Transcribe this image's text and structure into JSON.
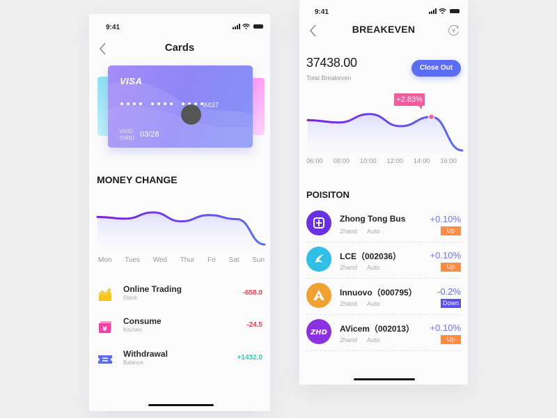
{
  "left_screen": {
    "status": {
      "time": "9:41"
    },
    "nav": {
      "title": "Cards"
    },
    "card": {
      "brand": "VISA",
      "last4": "8437",
      "valid_label": "VAIID THRU",
      "valid_date": "03/28"
    },
    "money_change": {
      "title": "MONEY CHANGE"
    },
    "transactions": [
      {
        "name": "Online Trading",
        "sub": "Stock",
        "amount": "-658.0",
        "icon": "trend-chart-icon",
        "amount_color": "#e8404f"
      },
      {
        "name": "Consume",
        "sub": "Kitchen",
        "amount": "-24.5",
        "icon": "ticket-icon",
        "amount_color": "#e8404f"
      },
      {
        "name": "Withdrawal",
        "sub": "Balance",
        "amount": "+1432.0",
        "icon": "voucher-icon",
        "amount_color": "#2dcfb3"
      }
    ]
  },
  "right_screen": {
    "status": {
      "time": "9:41"
    },
    "nav": {
      "title": "BREAKEVEN"
    },
    "total": {
      "amount": "37438.00",
      "label": "Total Breakeven"
    },
    "close_out_label": "Close Out",
    "tooltip": "+2.83%",
    "position_title": "POISITON",
    "positions": [
      {
        "name": "Zhong Tong Bus",
        "tag1": "2hand",
        "tag2": "Auto",
        "change": "+0.10%",
        "badge": "Up",
        "avatar_color": "#6a2fe0",
        "change_color": "#6f77f2",
        "badge_color": "#ff8b45"
      },
      {
        "name": "LCE（002036）",
        "tag1": "2hand",
        "tag2": "Auto",
        "change": "+0.10%",
        "badge": "Up",
        "avatar_color": "#30bfe6",
        "change_color": "#6f77f2",
        "badge_color": "#ff8b45"
      },
      {
        "name": "Innuovo（000795）",
        "tag1": "2hand",
        "tag2": "Auto",
        "change": "-0.2%",
        "badge": "Down",
        "avatar_color": "#f0a130",
        "change_color": "#5b6df5",
        "badge_color": "#5b4ff0"
      },
      {
        "name": "AVicem（002013）",
        "tag1": "2hand",
        "tag2": "Auto",
        "change": "+0.10%",
        "badge": "Up",
        "avatar_color": "#8b31e0",
        "change_color": "#6f77f2",
        "badge_color": "#ff8b45"
      }
    ]
  },
  "chart_data": [
    {
      "type": "area",
      "title": "MONEY CHANGE",
      "categories": [
        "Mon",
        "Tues",
        "Wed",
        "Thur",
        "Fri",
        "Sat",
        "Sun"
      ],
      "values": [
        62,
        58,
        72,
        52,
        66,
        57,
        0
      ],
      "ylim": [
        0,
        100
      ],
      "grid": false
    },
    {
      "type": "area",
      "title": "Total Breakeven",
      "categories": [
        "06:00",
        "08:00",
        "10:00",
        "12:00",
        "14:00",
        "16:00"
      ],
      "values": [
        65,
        60,
        78,
        52,
        72,
        0
      ],
      "highlight": {
        "category": "14:00",
        "label": "+2.83%"
      },
      "ylim": [
        0,
        100
      ],
      "grid": false
    }
  ]
}
